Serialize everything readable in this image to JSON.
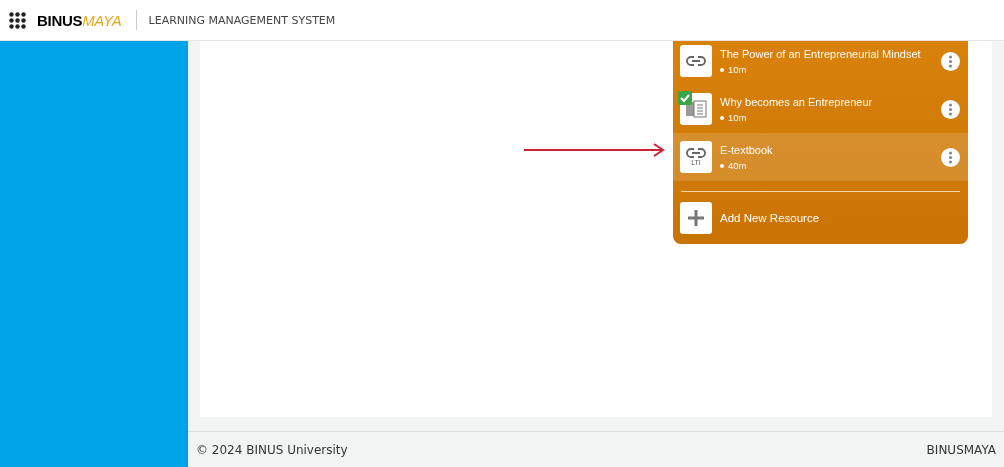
{
  "header": {
    "logo": {
      "primary": "BINUS",
      "accent": "MAYA"
    },
    "title": "LEARNING MANAGEMENT SYSTEM"
  },
  "resources": [
    {
      "kind": "link",
      "title": "The Power of an Entrepreneurial Mindset",
      "duration": "10m",
      "completed": false,
      "selected": false
    },
    {
      "kind": "document",
      "title": "Why becomes an Entrepreneur",
      "duration": "10m",
      "completed": true,
      "selected": false
    },
    {
      "kind": "lti",
      "title": "E-textbook",
      "duration": "40m",
      "completed": false,
      "selected": true,
      "badge": "LTI"
    }
  ],
  "add_resource": {
    "label": "Add New Resource"
  },
  "footer": {
    "copyright": "© 2024 BINUS University",
    "brand": "BINUSMAYA"
  }
}
